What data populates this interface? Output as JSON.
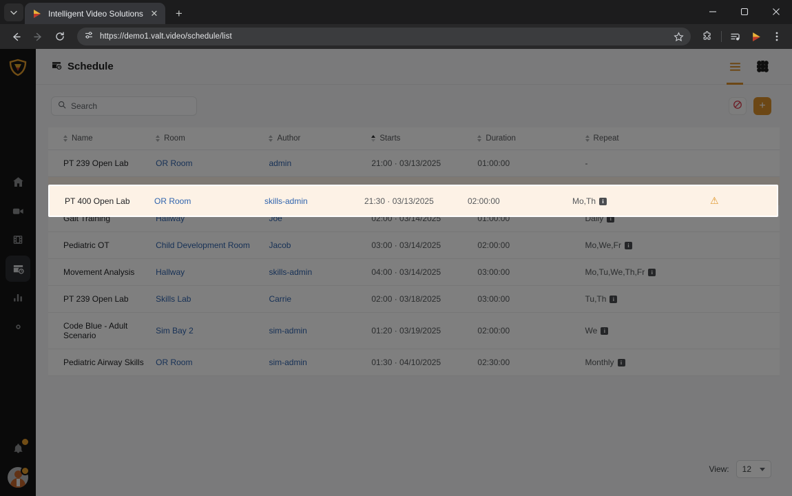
{
  "browser": {
    "tab_title": "Intelligent Video Solutions",
    "new_tab_label": "+",
    "close_label": "✕",
    "url": "https://demo1.valt.video/schedule/list",
    "minimize_label": "—",
    "maximize_label": "▢",
    "window_close_label": "✕"
  },
  "sidebar": {
    "items": [
      {
        "name": "home",
        "label": "Home"
      },
      {
        "name": "video",
        "label": "Live"
      },
      {
        "name": "film",
        "label": "Recordings"
      },
      {
        "name": "schedule",
        "label": "Schedule"
      },
      {
        "name": "analytics",
        "label": "Analytics"
      },
      {
        "name": "settings",
        "label": "Settings"
      }
    ],
    "notifications_label": "Notifications",
    "account_label": "Account"
  },
  "header": {
    "title": "Schedule",
    "view_list_label": "List view",
    "view_calendar_label": "Calendar view"
  },
  "toolbar": {
    "search_placeholder": "Search",
    "search_value": "",
    "block_label": "Blackout",
    "add_label": "+"
  },
  "table": {
    "columns": [
      {
        "key": "name",
        "label": "Name",
        "sorted": false
      },
      {
        "key": "room",
        "label": "Room",
        "sorted": false
      },
      {
        "key": "author",
        "label": "Author",
        "sorted": false
      },
      {
        "key": "starts",
        "label": "Starts",
        "sorted": true
      },
      {
        "key": "duration",
        "label": "Duration",
        "sorted": false
      },
      {
        "key": "repeat",
        "label": "Repeat",
        "sorted": false
      }
    ],
    "rows": [
      {
        "name": "PT 239 Open Lab",
        "room": "OR Room",
        "author": "admin",
        "starts": "21:00 · 03/13/2025",
        "duration": "01:00:00",
        "repeat": "-",
        "has_info": false,
        "warning": false,
        "highlight": false
      },
      {
        "name": "PT 400 Open Lab",
        "room": "OR Room",
        "author": "skills-admin",
        "starts": "21:30 · 03/13/2025",
        "duration": "02:00:00",
        "repeat": "Mo,Th",
        "has_info": true,
        "warning": true,
        "highlight": true
      },
      {
        "name": "Gait Training",
        "room": "Hallway",
        "author": "Joe",
        "starts": "02:00 · 03/14/2025",
        "duration": "01:00:00",
        "repeat": "Daily",
        "has_info": true,
        "warning": false,
        "highlight": false
      },
      {
        "name": "Pediatric OT",
        "room": "Child Development Room",
        "author": "Jacob",
        "starts": "03:00 · 03/14/2025",
        "duration": "02:00:00",
        "repeat": "Mo,We,Fr",
        "has_info": true,
        "warning": false,
        "highlight": false
      },
      {
        "name": "Movement Analysis",
        "room": "Hallway",
        "author": "skills-admin",
        "starts": "04:00 · 03/14/2025",
        "duration": "03:00:00",
        "repeat": "Mo,Tu,We,Th,Fr",
        "has_info": true,
        "warning": false,
        "highlight": false
      },
      {
        "name": "PT 239 Open Lab",
        "room": "Skills Lab",
        "author": "Carrie",
        "starts": "02:00 · 03/18/2025",
        "duration": "03:00:00",
        "repeat": "Tu,Th",
        "has_info": true,
        "warning": false,
        "highlight": false
      },
      {
        "name": "Code Blue - Adult Scenario",
        "room": "Sim Bay 2",
        "author": "sim-admin",
        "starts": "01:20 · 03/19/2025",
        "duration": "02:00:00",
        "repeat": "We",
        "has_info": true,
        "warning": false,
        "highlight": false
      },
      {
        "name": "Pediatric Airway Skills",
        "room": "OR Room",
        "author": "sim-admin",
        "starts": "01:30 · 04/10/2025",
        "duration": "02:30:00",
        "repeat": "Monthly",
        "has_info": true,
        "warning": false,
        "highlight": false
      }
    ],
    "info_badge_label": "i"
  },
  "footer": {
    "view_label": "View:",
    "page_size": "12"
  },
  "colors": {
    "accent": "#d98f2b",
    "link": "#2f63ad",
    "highlight_row": "#fdf2e6",
    "warning": "#e0982c",
    "sidebar_bg": "#141414"
  }
}
